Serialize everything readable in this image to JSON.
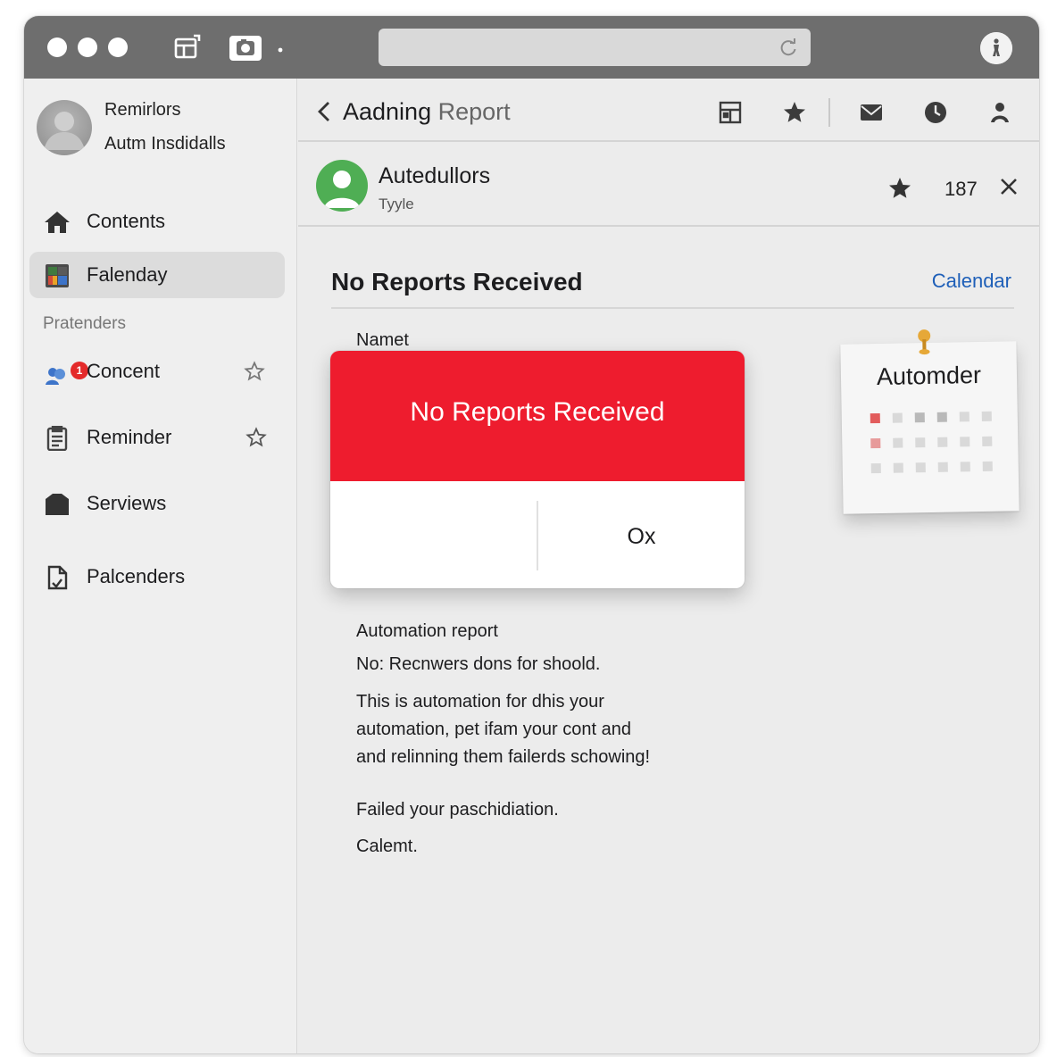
{
  "window": {
    "accent_color": "#ee1c2e",
    "link_color": "#1e5fb8"
  },
  "sidebar": {
    "account": {
      "name": "Remirlors",
      "subtitle": "Autm Insdidalls"
    },
    "items": [
      {
        "label": "Contents",
        "icon": "home-icon"
      },
      {
        "label": "Falenday",
        "icon": "calendar-grid-icon",
        "active": true
      }
    ],
    "section_label": "Pratenders",
    "section_items": [
      {
        "label": "Concent",
        "icon": "people-icon",
        "badge": "1",
        "starred": false
      },
      {
        "label": "Reminder",
        "icon": "clipboard-icon",
        "starred": false
      },
      {
        "label": "Serviews",
        "icon": "folder-icon"
      },
      {
        "label": "Palcenders",
        "icon": "document-icon"
      }
    ]
  },
  "main": {
    "header": {
      "title_part1": "Aadning",
      "title_part2": "Report"
    },
    "sender": {
      "name": "Autedullors",
      "type": "Tyyle",
      "count": "187"
    },
    "subject": "No Reports Received",
    "calendar_link": "Calendar",
    "name_label": "Namet",
    "sticky_note": {
      "title": "Automder"
    },
    "body": {
      "report_label": "Automation report",
      "line1": "No: Recnwers dons for shoold.",
      "para_line1": "This is automation for dhis your",
      "para_line2": "automation, pet ifam your cont and",
      "para_line3": "and relinning them failerds schowing!",
      "failed": "Failed your paschidiation.",
      "signoff": "Calemt."
    }
  },
  "alert": {
    "title": "No Reports Received",
    "ok_label": "Ox"
  }
}
